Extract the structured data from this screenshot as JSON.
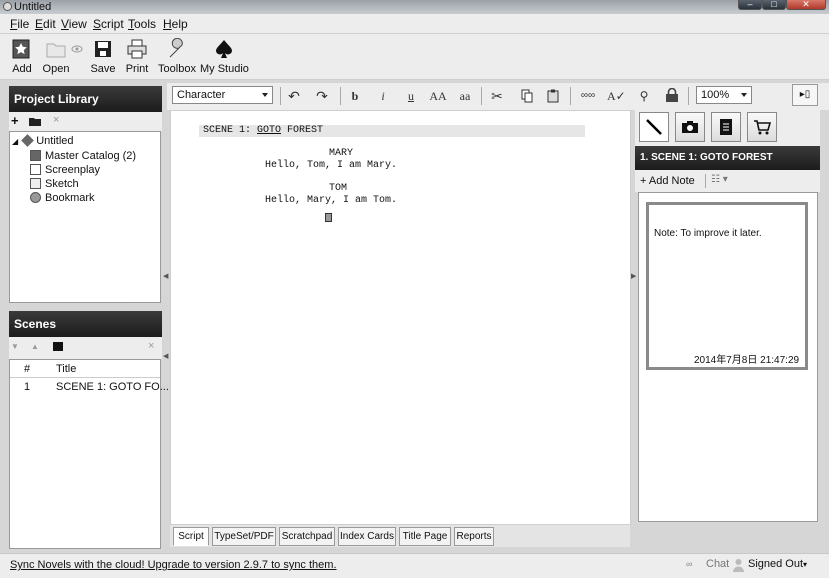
{
  "window": {
    "title": "Untitled"
  },
  "menu": [
    {
      "label": "File",
      "ul": "F",
      "rest": "ile"
    },
    {
      "label": "Edit",
      "ul": "E",
      "rest": "dit"
    },
    {
      "label": "View",
      "ul": "V",
      "rest": "iew"
    },
    {
      "label": "Script",
      "ul": "S",
      "rest": "cript"
    },
    {
      "label": "Tools",
      "ul": "T",
      "rest": "ools"
    },
    {
      "label": "Help",
      "ul": "H",
      "rest": "elp"
    }
  ],
  "toolbar": {
    "add": "Add",
    "open": "Open",
    "save": "Save",
    "print": "Print",
    "toolbox": "Toolbox",
    "my_studio": "My Studio"
  },
  "format_toolbar": {
    "element_type": "Character",
    "bold": "b",
    "italic": "i",
    "underline": "u",
    "upper": "AA",
    "lower": "aa",
    "zoom": "100%"
  },
  "project_library": {
    "title": "Project Library",
    "root": "Untitled",
    "items": [
      "Master Catalog (2)",
      "Screenplay",
      "Sketch",
      "Bookmark"
    ]
  },
  "scenes": {
    "title": "Scenes",
    "columns": [
      "#",
      "Title"
    ],
    "rows": [
      {
        "num": "1",
        "title": "SCENE 1: GOTO FO..."
      }
    ]
  },
  "script": {
    "scene_heading_prefix": "SCENE 1: ",
    "scene_heading_goto": "GOTO",
    "scene_heading_suffix": " FOREST",
    "char1": "MARY",
    "dialog1": "Hello, Tom, I am Mary.",
    "char2": "TOM",
    "dialog2": "Hello, Mary, I am Tom."
  },
  "bottom_tabs": [
    "Script",
    "TypeSet/PDF",
    "Scratchpad",
    "Index Cards",
    "Title Page",
    "Reports"
  ],
  "right_panel": {
    "scene_title": "1. SCENE 1: GOTO FOREST",
    "add_note": "+ Add Note",
    "note_text": "Note: To improve it later.",
    "note_timestamp": "2014年7月8日 21:47:29"
  },
  "status": {
    "sync_message": "Sync Novels with the cloud! Upgrade to version 2.9.7 to sync them.",
    "chat": "Chat",
    "signed_out": "Signed Out"
  },
  "colors": {
    "panel_header": "#262626",
    "chrome": "#ededed",
    "highlight_line": "#e6e6e6"
  }
}
